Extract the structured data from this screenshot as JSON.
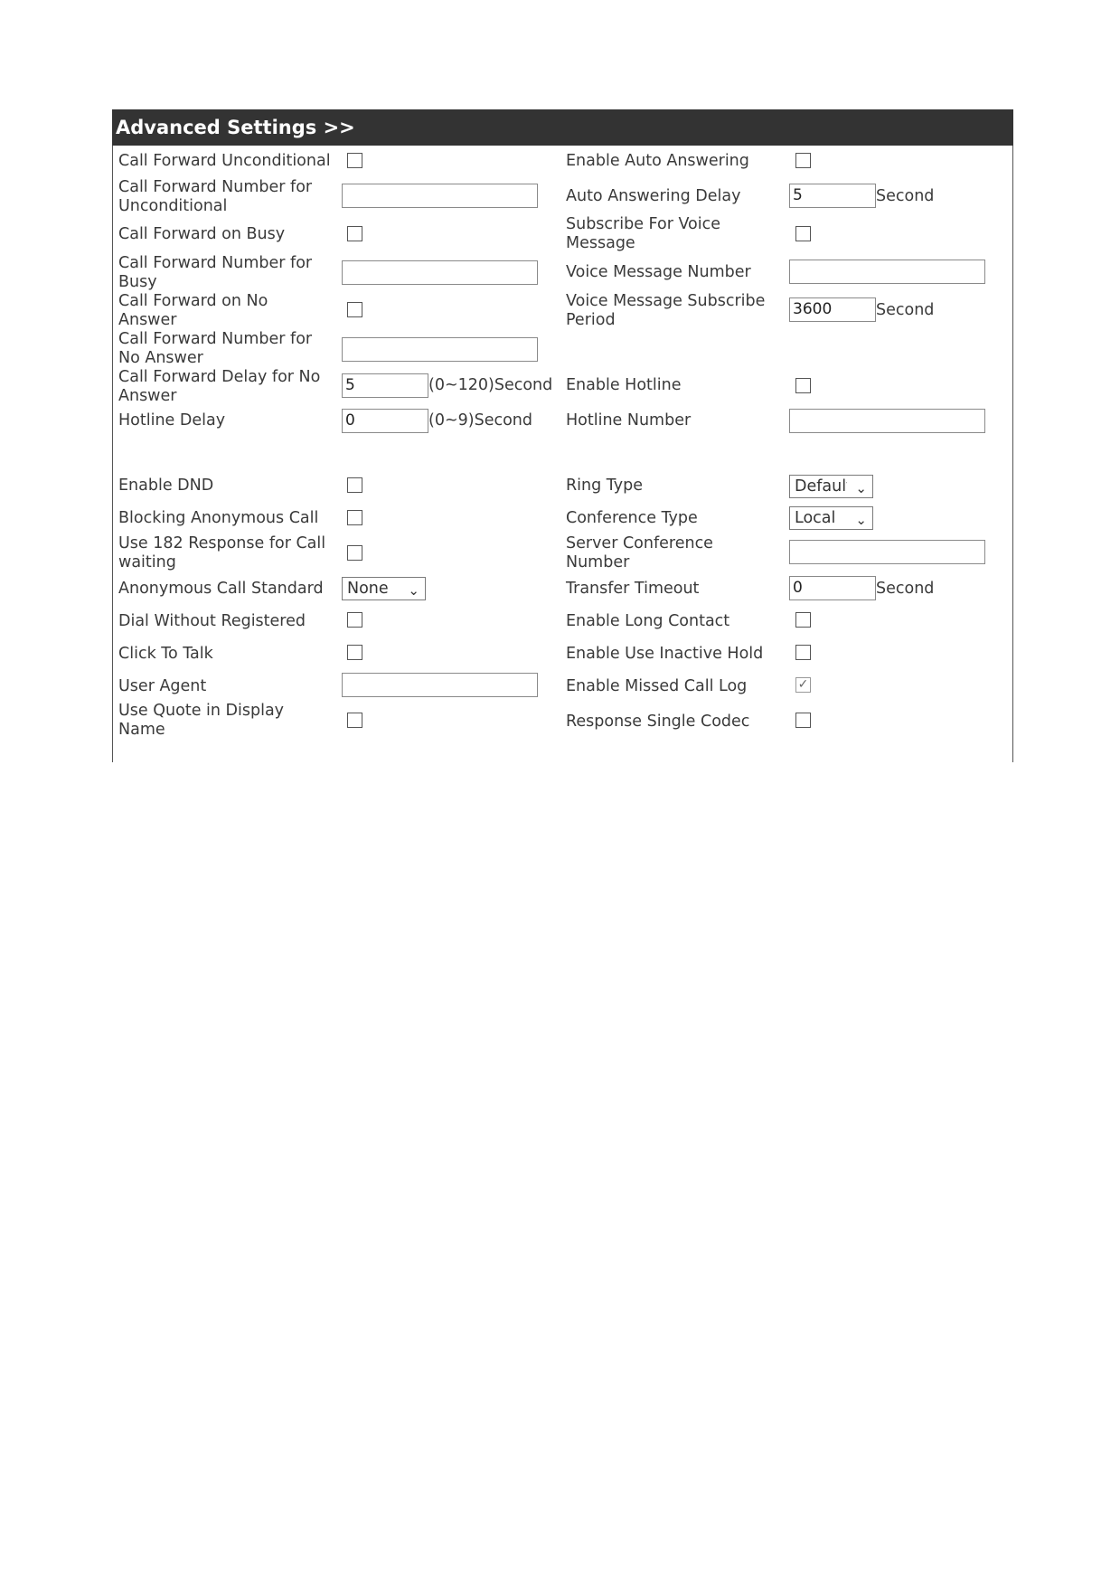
{
  "header": {
    "title": "Advanced Settings >>"
  },
  "left": {
    "call_forward_unconditional": "Call Forward Unconditional",
    "call_forward_number_unconditional": [
      "Call Forward Number for",
      "Unconditional"
    ],
    "call_forward_on_busy": "Call Forward on Busy",
    "call_forward_number_busy": [
      "Call Forward Number for",
      "Busy"
    ],
    "call_forward_no_answer": [
      "Call Forward on No",
      "Answer"
    ],
    "call_forward_number_no_answer": [
      "Call Forward Number for",
      "No Answer"
    ],
    "call_forward_delay_no_answer": [
      "Call Forward Delay for No",
      "Answer"
    ],
    "call_forward_delay_value": "5",
    "call_forward_delay_unit": "(0~120)Second",
    "hotline_delay": "Hotline Delay",
    "hotline_delay_value": "0",
    "hotline_delay_unit": "(0~9)Second",
    "enable_dnd": "Enable DND",
    "blocking_anonymous_call": "Blocking Anonymous Call",
    "use_182_response": [
      "Use 182 Response for Call",
      "waiting"
    ],
    "anonymous_call_standard": "Anonymous Call Standard",
    "anonymous_call_standard_value": "None",
    "dial_without_registered": "Dial Without Registered",
    "click_to_talk": "Click To Talk",
    "user_agent": "User Agent",
    "use_quote_display_name": [
      "Use Quote in Display",
      "Name"
    ]
  },
  "right": {
    "enable_auto_answering": "Enable Auto Answering",
    "auto_answering_delay": "Auto Answering Delay",
    "auto_answering_delay_value": "5",
    "auto_answering_delay_unit": "Second",
    "subscribe_voice_message": [
      "Subscribe For Voice",
      "Message"
    ],
    "voice_message_number": "Voice Message Number",
    "voice_message_subscribe_period": [
      "Voice Message Subscribe",
      "Period"
    ],
    "voice_message_subscribe_period_value": "3600",
    "voice_message_subscribe_period_unit": "Second",
    "enable_hotline": "Enable Hotline",
    "hotline_number": "Hotline Number",
    "ring_type": "Ring Type",
    "ring_type_value": "Default",
    "conference_type": "Conference Type",
    "conference_type_value": "Local",
    "server_conference_number": [
      "Server Conference",
      "Number"
    ],
    "transfer_timeout": "Transfer Timeout",
    "transfer_timeout_value": "0",
    "transfer_timeout_unit": "Second",
    "enable_long_contact": "Enable Long Contact",
    "enable_use_inactive_hold": "Enable Use Inactive Hold",
    "enable_missed_call_log": "Enable Missed Call Log",
    "response_single_codec": "Response Single Codec"
  },
  "checked_mark": "✓",
  "colors": {
    "header_bg": "#333333",
    "header_text": "#ffffff"
  }
}
